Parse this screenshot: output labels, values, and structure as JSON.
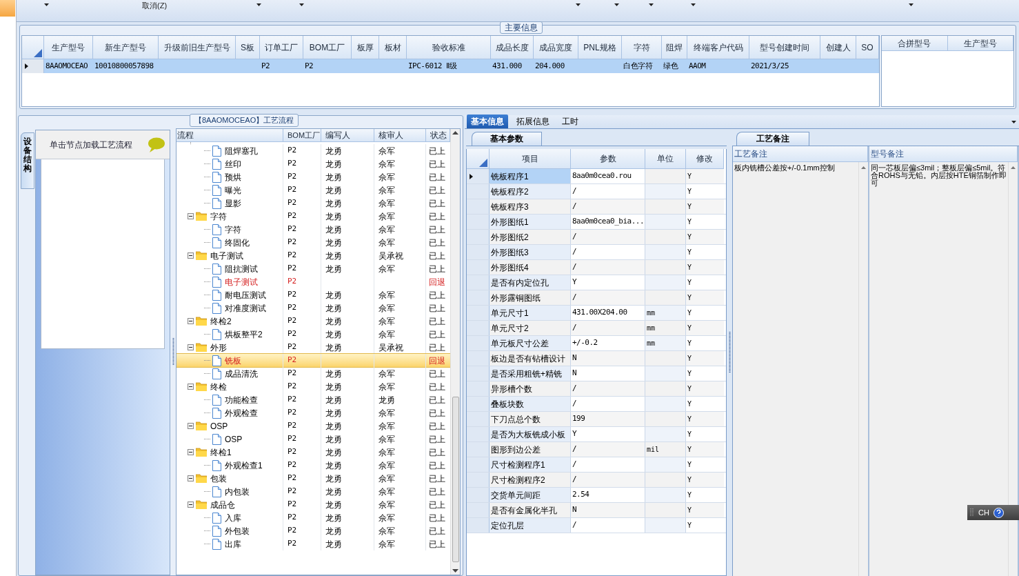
{
  "toolbar": [
    {
      "kind": "dropdown"
    },
    {
      "kind": "button",
      "label": "取消(Z)"
    },
    {
      "kind": "dropdown"
    },
    {
      "kind": "dropdown"
    },
    {
      "kind": "dropdown"
    },
    {
      "kind": "dropdown"
    },
    {
      "kind": "dropdown"
    },
    {
      "kind": "dropdown"
    },
    {
      "kind": "dropdown"
    }
  ],
  "main_info": {
    "title": "主要信息",
    "row_selected": true,
    "columns": [
      {
        "label": "生产型号",
        "value": "8AAOMOCEAO"
      },
      {
        "label": "新生产型号",
        "value": "10010800057898"
      },
      {
        "label": "升级前旧生产型号"
      },
      {
        "label": "S板"
      },
      {
        "label": "订单工厂",
        "value": "P2"
      },
      {
        "label": "BOM工厂",
        "value": "P2"
      },
      {
        "label": "板厚"
      },
      {
        "label": "板材"
      },
      {
        "label": "验收标准",
        "value": "IPC-6012 Ⅱ级"
      },
      {
        "label": "成品长度",
        "value": "431.000"
      },
      {
        "label": "成品宽度",
        "value": "204.000"
      },
      {
        "label": "PNL规格"
      },
      {
        "label": "字符",
        "value": "白色字符"
      },
      {
        "label": "阻焊",
        "value": "绿色"
      },
      {
        "label": "终端客户代码",
        "value": "AAOM"
      },
      {
        "label": "型号创建时间",
        "value": "2021/3/25"
      },
      {
        "label": "创建人"
      },
      {
        "label": "SO"
      }
    ],
    "merge_columns": [
      "合拼型号",
      "生产型号"
    ]
  },
  "side_tab": "设备结构",
  "hint": "单击节点加载工艺流程",
  "flow": {
    "title": "【8AAOMOCEAO】工艺流程",
    "columns": [
      "流程",
      "BOM工厂",
      "编写人",
      "核审人",
      "状态"
    ],
    "nodes": [
      {
        "children": [
          {
            "label": "阻焊塞孔",
            "bom": "P2",
            "writer": "龙勇",
            "reviewer": "佘军",
            "status": "已上",
            "returned": false,
            "selected": false
          },
          {
            "label": "丝印",
            "bom": "P2",
            "writer": "龙勇",
            "reviewer": "佘军",
            "status": "已上",
            "returned": false,
            "selected": false
          },
          {
            "label": "预烘",
            "bom": "P2",
            "writer": "龙勇",
            "reviewer": "佘军",
            "status": "已上",
            "returned": false,
            "selected": false
          },
          {
            "label": "曝光",
            "bom": "P2",
            "writer": "龙勇",
            "reviewer": "佘军",
            "status": "已上",
            "returned": false,
            "selected": false
          },
          {
            "label": "显影",
            "bom": "P2",
            "writer": "龙勇",
            "reviewer": "佘军",
            "status": "已上",
            "returned": false,
            "selected": false
          }
        ]
      },
      {
        "label": "字符",
        "bom": "P2",
        "writer": "龙勇",
        "reviewer": "佘军",
        "status": "已上",
        "returned": false,
        "selected": false,
        "expanded": true,
        "children": [
          {
            "label": "字符",
            "bom": "P2",
            "writer": "龙勇",
            "reviewer": "佘军",
            "status": "已上",
            "returned": false,
            "selected": false
          },
          {
            "label": "终固化",
            "bom": "P2",
            "writer": "龙勇",
            "reviewer": "佘军",
            "status": "已上",
            "returned": false,
            "selected": false
          }
        ]
      },
      {
        "label": "电子测试",
        "bom": "P2",
        "writer": "龙勇",
        "reviewer": "吴承祝",
        "status": "已上",
        "returned": false,
        "selected": false,
        "expanded": true,
        "children": [
          {
            "label": "阻抗测试",
            "bom": "P2",
            "writer": "龙勇",
            "reviewer": "佘军",
            "status": "已上",
            "returned": false,
            "selected": false
          },
          {
            "label": "电子测试",
            "bom": "P2",
            "status": "回退",
            "returned": true,
            "selected": false
          },
          {
            "label": "耐电压测试",
            "bom": "P2",
            "writer": "龙勇",
            "reviewer": "佘军",
            "status": "已上",
            "returned": false,
            "selected": false
          },
          {
            "label": "对准度测试",
            "bom": "P2",
            "writer": "龙勇",
            "reviewer": "佘军",
            "status": "已上",
            "returned": false,
            "selected": false
          }
        ]
      },
      {
        "label": "终检2",
        "bom": "P2",
        "writer": "龙勇",
        "reviewer": "佘军",
        "status": "已上",
        "returned": false,
        "selected": false,
        "expanded": true,
        "children": [
          {
            "label": "烘板整平2",
            "bom": "P2",
            "writer": "龙勇",
            "reviewer": "佘军",
            "status": "已上",
            "returned": false,
            "selected": false
          }
        ]
      },
      {
        "label": "外形",
        "bom": "P2",
        "writer": "龙勇",
        "reviewer": "吴承祝",
        "status": "已上",
        "returned": false,
        "selected": false,
        "expanded": true,
        "children": [
          {
            "label": "铣板",
            "bom": "P2",
            "status": "回退",
            "returned": true,
            "selected": true
          },
          {
            "label": "成品清洗",
            "bom": "P2",
            "writer": "龙勇",
            "reviewer": "佘军",
            "status": "已上",
            "returned": false,
            "selected": false
          }
        ]
      },
      {
        "label": "终检",
        "bom": "P2",
        "writer": "龙勇",
        "reviewer": "佘军",
        "status": "已上",
        "returned": false,
        "selected": false,
        "expanded": true,
        "children": [
          {
            "label": "功能检查",
            "bom": "P2",
            "writer": "龙勇",
            "reviewer": "龙勇",
            "status": "已上",
            "returned": false,
            "selected": false
          },
          {
            "label": "外观检查",
            "bom": "P2",
            "writer": "龙勇",
            "reviewer": "佘军",
            "status": "已上",
            "returned": false,
            "selected": false
          }
        ]
      },
      {
        "label": "OSP",
        "bom": "P2",
        "writer": "龙勇",
        "reviewer": "佘军",
        "status": "已上",
        "returned": false,
        "selected": false,
        "expanded": true,
        "children": [
          {
            "label": "OSP",
            "bom": "P2",
            "writer": "龙勇",
            "reviewer": "佘军",
            "status": "已上",
            "returned": false,
            "selected": false
          }
        ]
      },
      {
        "label": "终检1",
        "bom": "P2",
        "writer": "龙勇",
        "reviewer": "佘军",
        "status": "已上",
        "returned": false,
        "selected": false,
        "expanded": true,
        "children": [
          {
            "label": "外观检查1",
            "bom": "P2",
            "writer": "龙勇",
            "reviewer": "佘军",
            "status": "已上",
            "returned": false,
            "selected": false
          }
        ]
      },
      {
        "label": "包装",
        "bom": "P2",
        "writer": "龙勇",
        "reviewer": "佘军",
        "status": "已上",
        "returned": false,
        "selected": false,
        "expanded": true,
        "children": [
          {
            "label": "内包装",
            "bom": "P2",
            "writer": "龙勇",
            "reviewer": "佘军",
            "status": "已上",
            "returned": false,
            "selected": false
          }
        ]
      },
      {
        "label": "成品仓",
        "bom": "P2",
        "writer": "龙勇",
        "reviewer": "佘军",
        "status": "已上",
        "returned": false,
        "selected": false,
        "expanded": true,
        "children": [
          {
            "label": "入库",
            "bom": "P2",
            "writer": "龙勇",
            "reviewer": "佘军",
            "status": "已上",
            "returned": false,
            "selected": false
          },
          {
            "label": "外包装",
            "bom": "P2",
            "writer": "龙勇",
            "reviewer": "佘军",
            "status": "已上",
            "returned": false,
            "selected": false
          },
          {
            "label": "出库",
            "bom": "P2",
            "writer": "龙勇",
            "reviewer": "佘军",
            "status": "已上",
            "returned": false,
            "selected": false
          }
        ]
      }
    ]
  },
  "tabs": [
    {
      "label": "基本信息",
      "selected": true
    },
    {
      "label": "拓展信息",
      "selected": false
    },
    {
      "label": "工时",
      "selected": false
    }
  ],
  "params": {
    "title": "基本参数",
    "columns": [
      "项目",
      "参数",
      "单位",
      "修改"
    ],
    "rows": [
      {
        "item": "铣板程序1",
        "value": "8aa0m0cea0.rou",
        "modify": "Y",
        "selected": true
      },
      {
        "item": "铣板程序2",
        "value": "/",
        "modify": "Y",
        "selected": false
      },
      {
        "item": "铣板程序3",
        "value": "/",
        "modify": "Y",
        "selected": false
      },
      {
        "item": "外形图纸1",
        "value": "8aa0m0cea0_bia...",
        "modify": "Y",
        "selected": false
      },
      {
        "item": "外形图纸2",
        "value": "/",
        "modify": "Y",
        "selected": false
      },
      {
        "item": "外形图纸3",
        "value": "/",
        "modify": "Y",
        "selected": false
      },
      {
        "item": "外形图纸4",
        "value": "/",
        "modify": "Y",
        "selected": false
      },
      {
        "item": "是否有内定位孔",
        "value": "Y",
        "modify": "Y",
        "selected": false
      },
      {
        "item": "外形露铜图纸",
        "value": "/",
        "modify": "Y",
        "selected": false
      },
      {
        "item": "单元尺寸1",
        "value": "431.00X204.00",
        "unit": "mm",
        "modify": "Y",
        "selected": false
      },
      {
        "item": "单元尺寸2",
        "value": "/",
        "unit": "mm",
        "modify": "Y",
        "selected": false
      },
      {
        "item": "单元板尺寸公差",
        "value": "+/-0.2",
        "unit": "mm",
        "modify": "Y",
        "selected": false
      },
      {
        "item": "板边是否有钻槽设计",
        "value": "N",
        "modify": "Y",
        "selected": false
      },
      {
        "item": "是否采用粗铣+精铣",
        "value": "N",
        "modify": "Y",
        "selected": false
      },
      {
        "item": "异形槽个数",
        "value": "/",
        "modify": "Y",
        "selected": false
      },
      {
        "item": "叠板块数",
        "value": "/",
        "modify": "Y",
        "selected": false
      },
      {
        "item": "下刀点总个数",
        "value": "199",
        "modify": "Y",
        "selected": false
      },
      {
        "item": "是否为大板铣成小板",
        "value": "Y",
        "modify": "Y",
        "selected": false
      },
      {
        "item": "图形到边公差",
        "value": "/",
        "unit": "mil",
        "modify": "Y",
        "selected": false
      },
      {
        "item": "尺寸检测程序1",
        "value": "/",
        "modify": "Y",
        "selected": false
      },
      {
        "item": "尺寸检测程序2",
        "value": "/",
        "modify": "Y",
        "selected": false
      },
      {
        "item": "交货单元间距",
        "value": "2.54",
        "modify": "Y",
        "selected": false
      },
      {
        "item": "是否有金属化半孔",
        "value": "N",
        "modify": "Y",
        "selected": false
      },
      {
        "item": "定位孔层",
        "value": "/",
        "modify": "Y",
        "selected": false
      }
    ]
  },
  "notes": {
    "title": "工艺备注",
    "columns": [
      {
        "label": "工艺备注",
        "text": "板内铣槽公差按+/-0.1mm控制"
      },
      {
        "label": "型号备注",
        "text": "同一芯板层偏≤3mil；整板层偏≤5mil。符合ROHS与无铅。内层按HTE铜箔制作即可"
      }
    ]
  },
  "language_bar": {
    "label": "CH"
  }
}
